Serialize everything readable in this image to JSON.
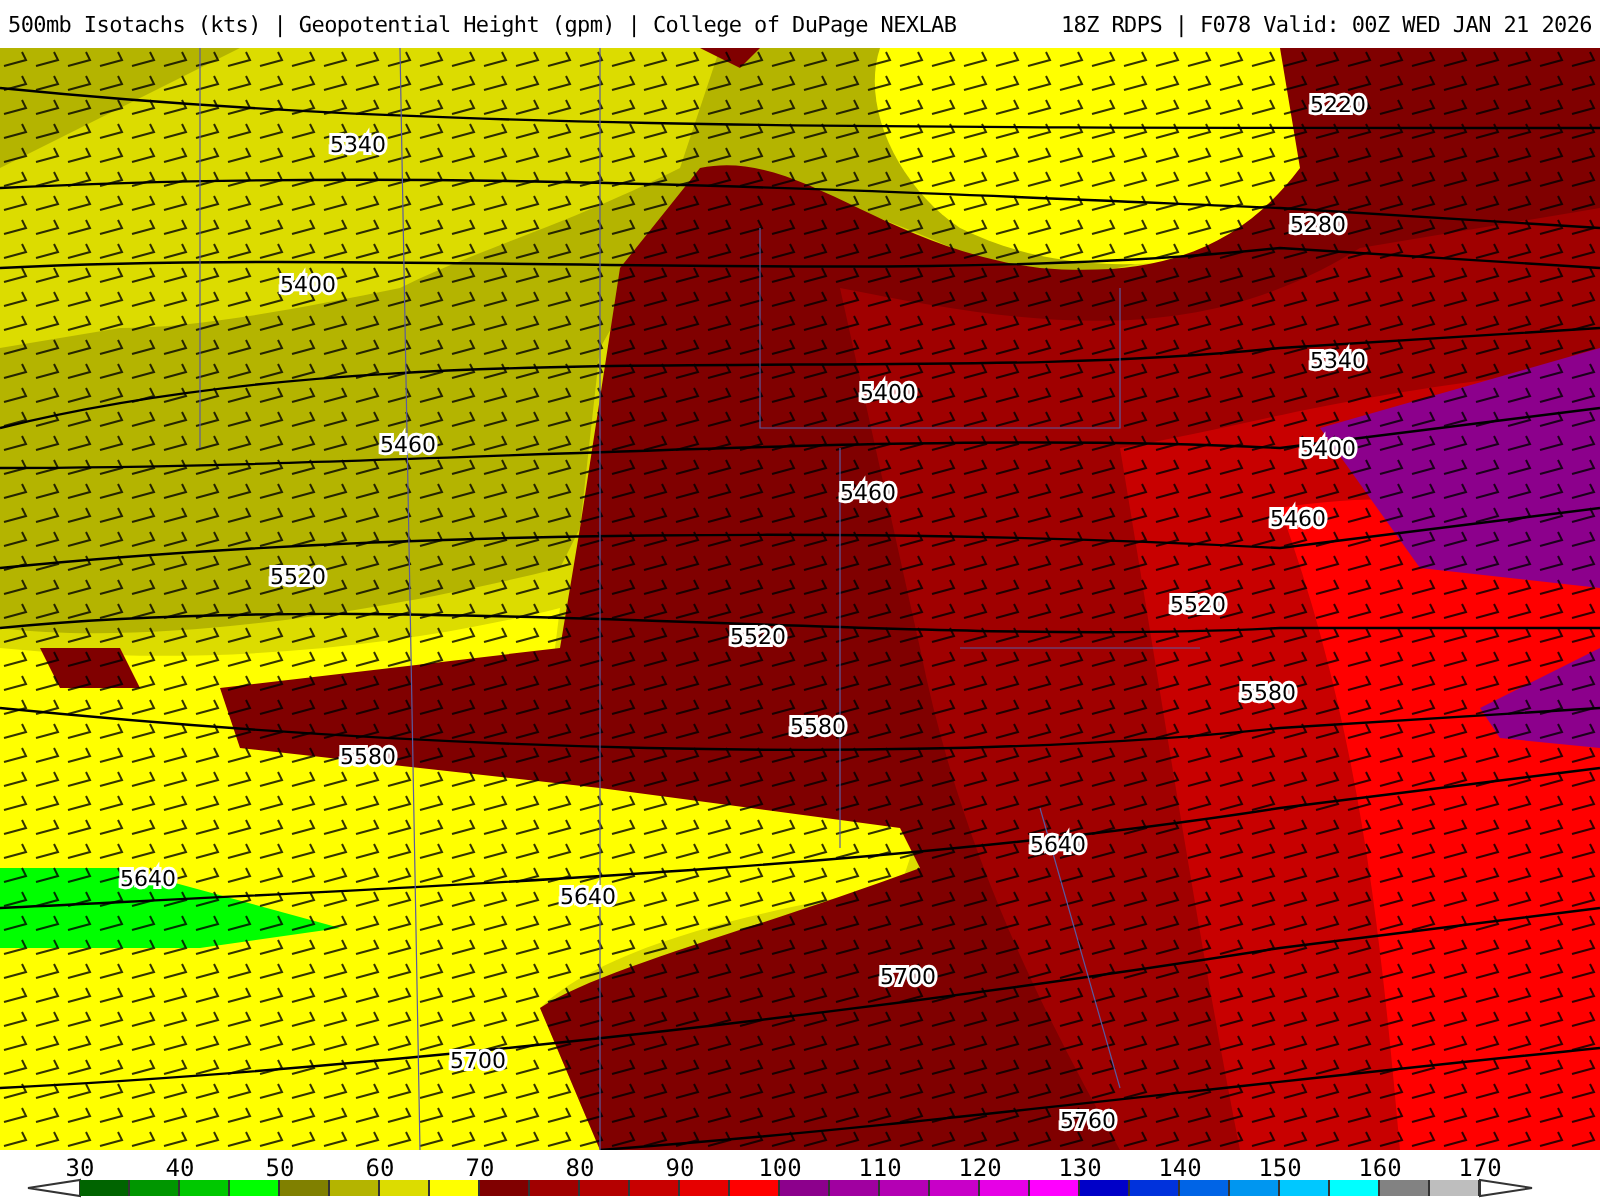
{
  "header": {
    "title": "500mb Isotachs (kts) | Geopotential Height (gpm) | College of DuPage NEXLAB",
    "run": "18Z RDPS | F078 Valid: 00Z WED JAN 21 2026"
  },
  "contour_labels": [
    "5220",
    "5340",
    "5280",
    "5400",
    "5340",
    "5400",
    "5400",
    "5460",
    "5460",
    "5460",
    "5520",
    "5520",
    "5520",
    "5580",
    "5580",
    "5580",
    "5640",
    "5640",
    "5640",
    "5700",
    "5700",
    "5760"
  ],
  "legend": {
    "labels": [
      "30",
      "40",
      "50",
      "60",
      "70",
      "80",
      "90",
      "100",
      "110",
      "120",
      "130",
      "140",
      "150",
      "160",
      "170"
    ],
    "swatches": [
      {
        "color": "#006400"
      },
      {
        "color": "#009600"
      },
      {
        "color": "#00c800"
      },
      {
        "color": "#00ff00"
      },
      {
        "color": "#808000"
      },
      {
        "color": "#b4b400"
      },
      {
        "color": "#dcdc00"
      },
      {
        "color": "#ffff00"
      },
      {
        "color": "#800000"
      },
      {
        "color": "#a00000"
      },
      {
        "color": "#b40000"
      },
      {
        "color": "#c80000"
      },
      {
        "color": "#e60000"
      },
      {
        "color": "#ff0000"
      },
      {
        "color": "#8c008c"
      },
      {
        "color": "#a000a0"
      },
      {
        "color": "#b400b4"
      },
      {
        "color": "#c800c8"
      },
      {
        "color": "#e600e6"
      },
      {
        "color": "#ff00ff"
      },
      {
        "color": "#0000c8"
      },
      {
        "color": "#0032dc"
      },
      {
        "color": "#0064e6"
      },
      {
        "color": "#0096f0"
      },
      {
        "color": "#00c8ff"
      },
      {
        "color": "#00ffff"
      },
      {
        "color": "#828282"
      },
      {
        "color": "#bebebe"
      }
    ]
  }
}
